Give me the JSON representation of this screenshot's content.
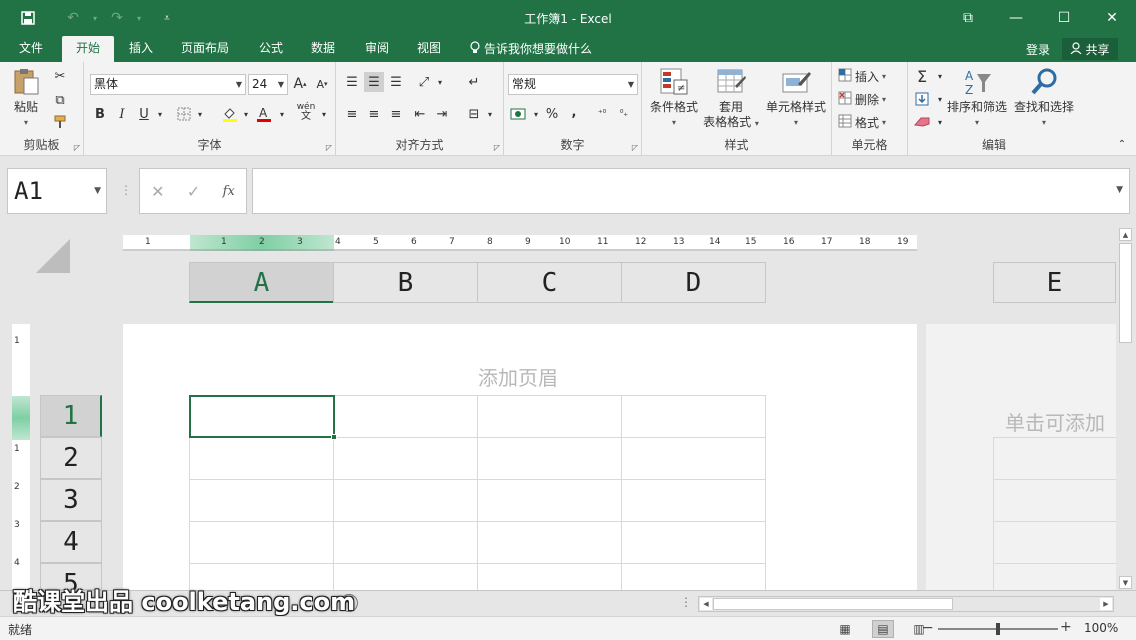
{
  "window": {
    "title": "工作簿1 - Excel",
    "controls": [
      "⧉",
      "—",
      "☐",
      "✕"
    ]
  },
  "menu": {
    "tabs": [
      "文件",
      "开始",
      "插入",
      "页面布局",
      "公式",
      "数据",
      "审阅",
      "视图"
    ],
    "active_tab": "开始",
    "tell_me": "告诉我你想要做什么",
    "login": "登录",
    "share": "共享"
  },
  "ribbon": {
    "clipboard": {
      "label": "剪贴板",
      "paste": "粘贴"
    },
    "font": {
      "label": "字体",
      "font_name": "黑体",
      "font_size": "24",
      "bold": "B",
      "italic": "I",
      "underline": "U",
      "increase": "A",
      "decrease": "A",
      "phonetic": "wén"
    },
    "alignment": {
      "label": "对齐方式"
    },
    "number": {
      "label": "数字",
      "format": "常规",
      "percent": "%",
      "comma": ","
    },
    "styles": {
      "label": "样式",
      "conditional": "条件格式",
      "table_format_1": "套用",
      "table_format_2": "表格格式",
      "cell_styles": "单元格样式"
    },
    "cells": {
      "label": "单元格",
      "insert": "插入",
      "delete": "删除",
      "format": "格式"
    },
    "editing": {
      "label": "编辑",
      "sort_filter": "排序和筛选",
      "find_select": "查找和选择"
    }
  },
  "formula_bar": {
    "name_box": "A1",
    "cancel": "✕",
    "enter": "✓",
    "fx": "fx",
    "value": ""
  },
  "sheet": {
    "columns": [
      "A",
      "B",
      "C",
      "D",
      "E"
    ],
    "rows": [
      "1",
      "2",
      "3",
      "4",
      "5"
    ],
    "selected_cell": "A1",
    "header_placeholder": "添加页眉",
    "header_placeholder_2": "单击可添加",
    "ruler_ticks": [
      "1",
      "1",
      "2",
      "3",
      "4",
      "5",
      "6",
      "7",
      "8",
      "9",
      "10",
      "11",
      "12",
      "13",
      "14",
      "15",
      "16",
      "17",
      "18",
      "19"
    ],
    "vruler_ticks": [
      "1",
      "1",
      "2",
      "3",
      "4"
    ]
  },
  "watermark": "酷课堂出品 coolketang.com",
  "statusbar": {
    "status": "就绪",
    "zoom": "100%",
    "zoom_level": 0.5
  },
  "colors": {
    "brand": "#217346",
    "ribbon_bg": "#f3f3f3",
    "canvas_bg": "#e6e6e6"
  }
}
